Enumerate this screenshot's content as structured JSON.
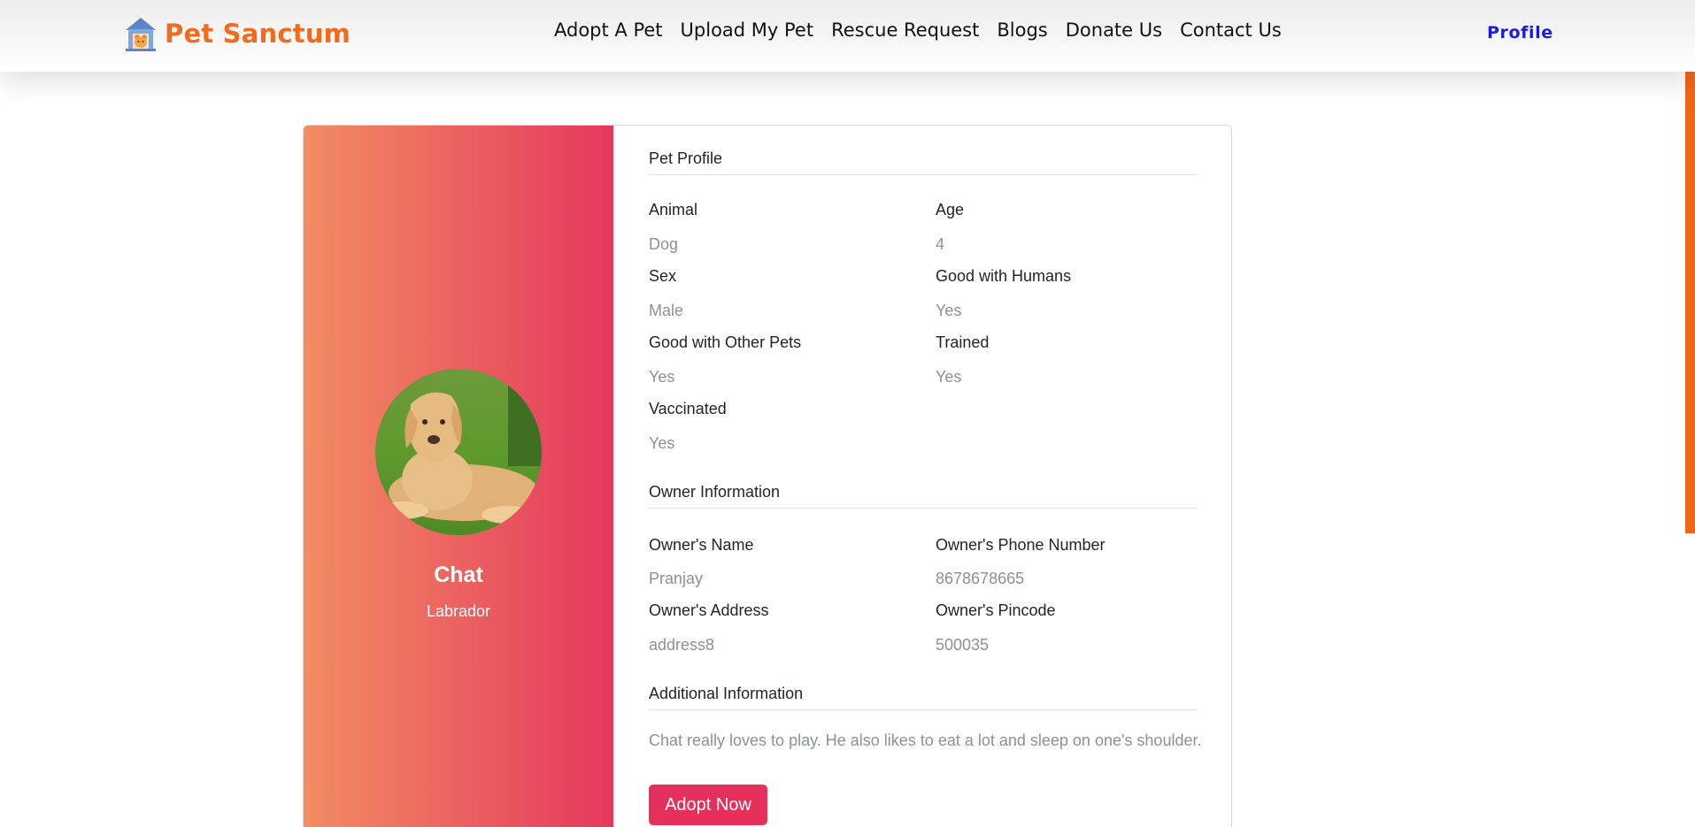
{
  "navbar": {
    "brand": "Pet Sanctum",
    "links": [
      "Adopt A Pet",
      "Upload My Pet",
      "Rescue Request",
      "Blogs",
      "Donate Us",
      "Contact Us"
    ],
    "profile": "Profile"
  },
  "pet": {
    "name": "Chat",
    "breed": "Labrador",
    "section_title": "Pet Profile",
    "fields": [
      {
        "label": "Animal",
        "value": "Dog"
      },
      {
        "label": "Age",
        "value": "4"
      },
      {
        "label": "Sex",
        "value": "Male"
      },
      {
        "label": "Good with Humans",
        "value": "Yes"
      },
      {
        "label": "Good with Other Pets",
        "value": "Yes"
      },
      {
        "label": "Trained",
        "value": "Yes"
      },
      {
        "label": "Vaccinated",
        "value": "Yes"
      }
    ]
  },
  "owner": {
    "section_title": "Owner Information",
    "fields": [
      {
        "label": "Owner's Name",
        "value": "Pranjay"
      },
      {
        "label": "Owner's Phone Number",
        "value": "8678678665"
      },
      {
        "label": "Owner's Address",
        "value": "address8"
      },
      {
        "label": "Owner's Pincode",
        "value": "500035"
      }
    ]
  },
  "additional": {
    "section_title": "Additional Information",
    "text": "Chat really loves to play. He also likes to eat a lot and sleep on one's shoulder."
  },
  "actions": {
    "adopt_label": "Adopt Now"
  },
  "colors": {
    "brand": "#f26b1d",
    "profile_link": "#1a1ae6",
    "gradient_start": "#f28c63",
    "gradient_end": "#e5385e",
    "button": "#e5305b"
  },
  "icons": {
    "logo": "pet-house-logo-icon"
  }
}
